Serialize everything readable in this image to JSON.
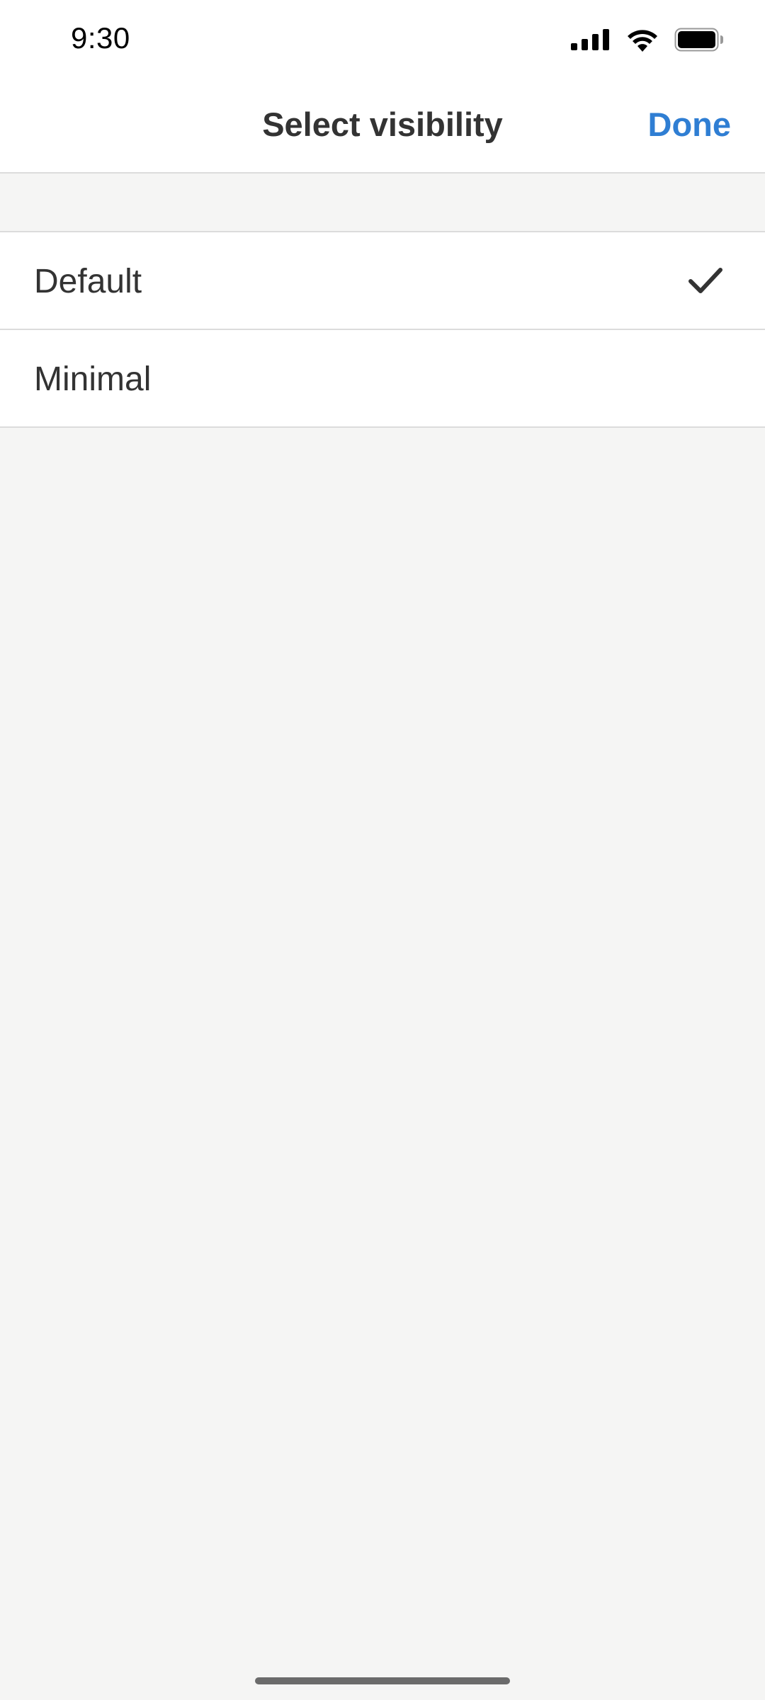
{
  "status_bar": {
    "time": "9:30",
    "icons": [
      "cellular-signal-icon",
      "wifi-icon",
      "battery-icon"
    ]
  },
  "nav": {
    "title": "Select visibility",
    "done_label": "Done"
  },
  "options": [
    {
      "label": "Default",
      "selected": true
    },
    {
      "label": "Minimal",
      "selected": false
    }
  ],
  "colors": {
    "accent": "#2f7ed3",
    "text": "#333333",
    "background": "#f5f5f4",
    "separator": "#dcdcdc"
  }
}
